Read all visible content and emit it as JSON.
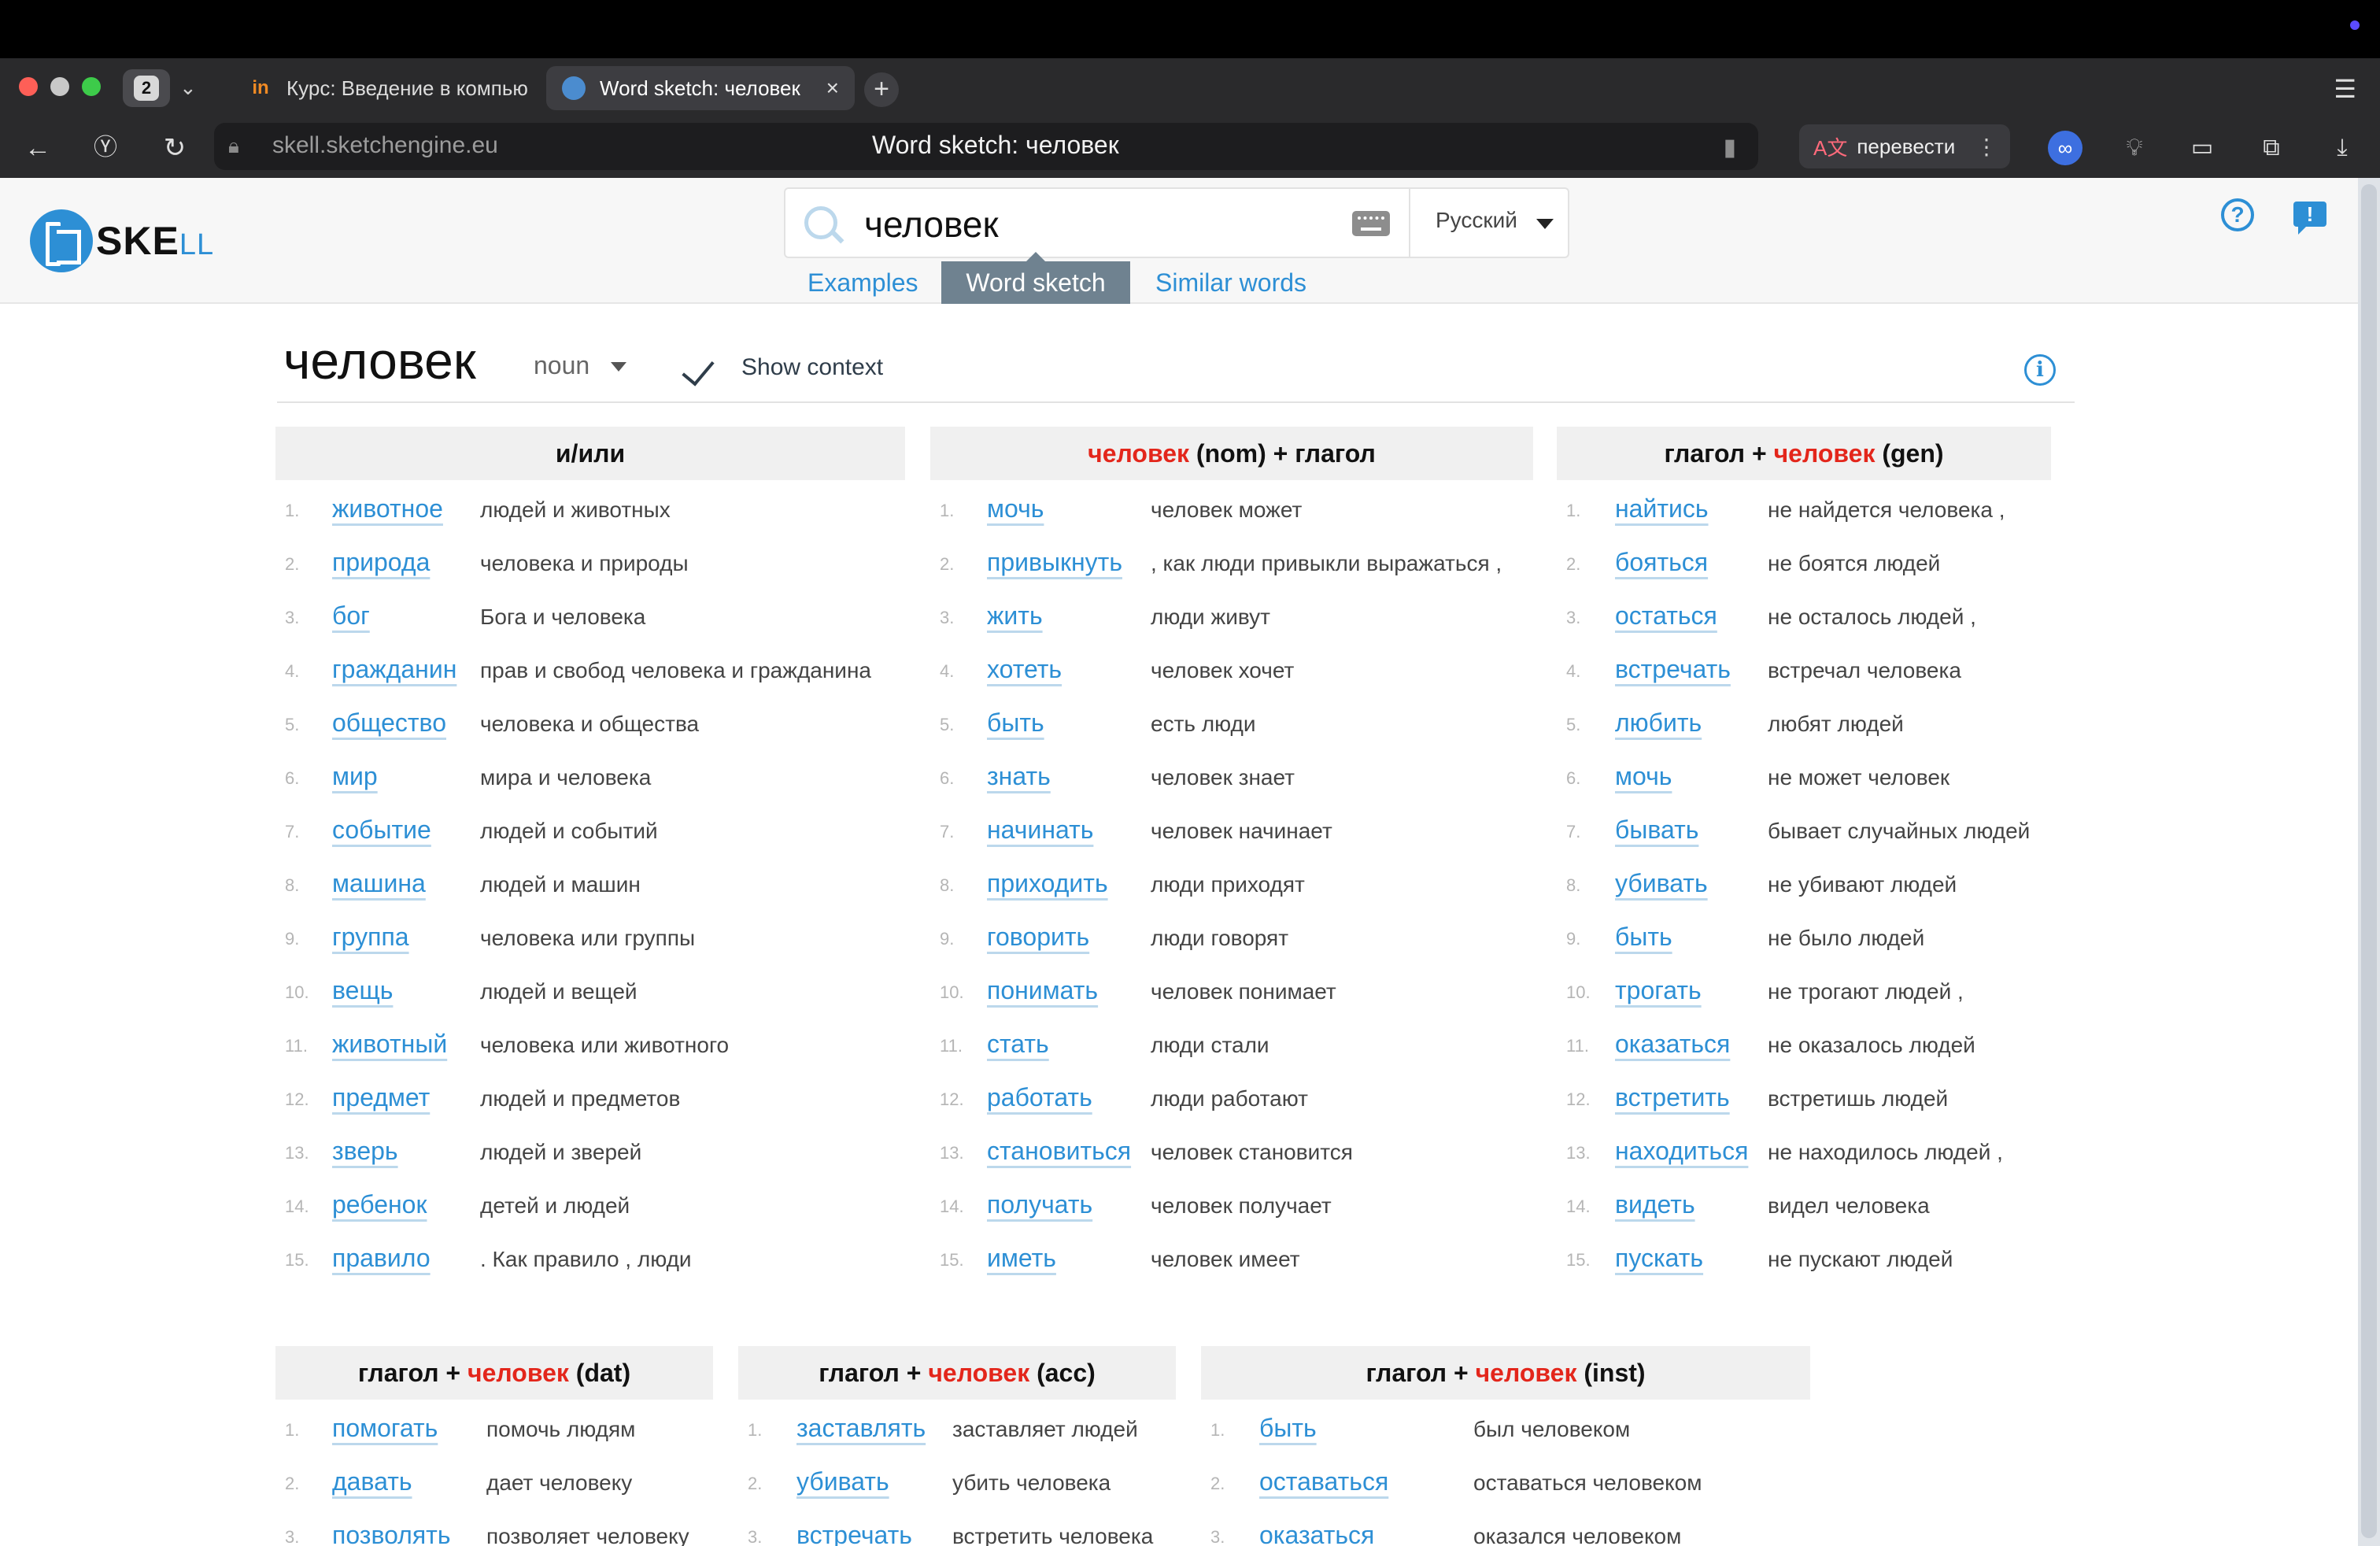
{
  "browser": {
    "tab_count": "2",
    "tabs": [
      {
        "label": "Курс: Введение в компью",
        "active": false
      },
      {
        "label": "Word sketch: человек",
        "active": true
      }
    ],
    "url": "skell.sketchengine.eu",
    "page_title": "Word sketch: человек",
    "translate_label": "перевести"
  },
  "header": {
    "logo_main": "SKE",
    "logo_accent": "LL",
    "search_value": "человек",
    "language": "Русский",
    "tabs": [
      "Examples",
      "Word sketch",
      "Similar words"
    ],
    "active_tab": "Word sketch"
  },
  "word": {
    "lemma": "человек",
    "pos": "noun",
    "show_context_label": "Show context"
  },
  "sketches": [
    {
      "title_pre": "и/или",
      "title_hw": "",
      "title_post": "",
      "rows": [
        {
          "n": "1.",
          "collocate": "животное",
          "example": "людей и животных"
        },
        {
          "n": "2.",
          "collocate": "природа",
          "example": "человека и природы"
        },
        {
          "n": "3.",
          "collocate": "бог",
          "example": "Бога и человека"
        },
        {
          "n": "4.",
          "collocate": "гражданин",
          "example": "прав и свобод человека и гражданина"
        },
        {
          "n": "5.",
          "collocate": "общество",
          "example": "человека и общества"
        },
        {
          "n": "6.",
          "collocate": "мир",
          "example": "мира и человека"
        },
        {
          "n": "7.",
          "collocate": "событие",
          "example": "людей и событий"
        },
        {
          "n": "8.",
          "collocate": "машина",
          "example": "людей и машин"
        },
        {
          "n": "9.",
          "collocate": "группа",
          "example": "человека или группы"
        },
        {
          "n": "10.",
          "collocate": "вещь",
          "example": "людей и вещей"
        },
        {
          "n": "11.",
          "collocate": "животный",
          "example": "человека или животного"
        },
        {
          "n": "12.",
          "collocate": "предмет",
          "example": "людей и предметов"
        },
        {
          "n": "13.",
          "collocate": "зверь",
          "example": "людей и зверей"
        },
        {
          "n": "14.",
          "collocate": "ребенок",
          "example": "детей и людей"
        },
        {
          "n": "15.",
          "collocate": "правило",
          "example": ". Как правило , люди"
        }
      ]
    },
    {
      "title_pre": "",
      "title_hw": "человек",
      "title_post": " (nom) + глагол",
      "rows": [
        {
          "n": "1.",
          "collocate": "мочь",
          "example": "человек может"
        },
        {
          "n": "2.",
          "collocate": "привыкнуть",
          "example": ", как люди привыкли выражаться ,"
        },
        {
          "n": "3.",
          "collocate": "жить",
          "example": "люди живут"
        },
        {
          "n": "4.",
          "collocate": "хотеть",
          "example": "человек хочет"
        },
        {
          "n": "5.",
          "collocate": "быть",
          "example": "есть люди"
        },
        {
          "n": "6.",
          "collocate": "знать",
          "example": "человек знает"
        },
        {
          "n": "7.",
          "collocate": "начинать",
          "example": "человек начинает"
        },
        {
          "n": "8.",
          "collocate": "приходить",
          "example": "люди приходят"
        },
        {
          "n": "9.",
          "collocate": "говорить",
          "example": "люди говорят"
        },
        {
          "n": "10.",
          "collocate": "понимать",
          "example": "человек понимает"
        },
        {
          "n": "11.",
          "collocate": "стать",
          "example": "люди стали"
        },
        {
          "n": "12.",
          "collocate": "работать",
          "example": "люди работают"
        },
        {
          "n": "13.",
          "collocate": "становиться",
          "example": "человек становится"
        },
        {
          "n": "14.",
          "collocate": "получать",
          "example": "человек получает"
        },
        {
          "n": "15.",
          "collocate": "иметь",
          "example": "человек имеет"
        }
      ]
    },
    {
      "title_pre": "глагол + ",
      "title_hw": "человек",
      "title_post": " (gen)",
      "rows": [
        {
          "n": "1.",
          "collocate": "найтись",
          "example": "не найдется человека ,"
        },
        {
          "n": "2.",
          "collocate": "бояться",
          "example": "не боятся людей"
        },
        {
          "n": "3.",
          "collocate": "остаться",
          "example": "не осталось людей ,"
        },
        {
          "n": "4.",
          "collocate": "встречать",
          "example": "встречал человека"
        },
        {
          "n": "5.",
          "collocate": "любить",
          "example": "любят людей"
        },
        {
          "n": "6.",
          "collocate": "мочь",
          "example": "не может человек"
        },
        {
          "n": "7.",
          "collocate": "бывать",
          "example": "бывает случайных людей"
        },
        {
          "n": "8.",
          "collocate": "убивать",
          "example": "не убивают людей"
        },
        {
          "n": "9.",
          "collocate": "быть",
          "example": "не было людей"
        },
        {
          "n": "10.",
          "collocate": "трогать",
          "example": "не трогают людей ,"
        },
        {
          "n": "11.",
          "collocate": "оказаться",
          "example": "не оказалось людей"
        },
        {
          "n": "12.",
          "collocate": "встретить",
          "example": "встретишь людей"
        },
        {
          "n": "13.",
          "collocate": "находиться",
          "example": "не находилось людей ,"
        },
        {
          "n": "14.",
          "collocate": "видеть",
          "example": "видел человека"
        },
        {
          "n": "15.",
          "collocate": "пускать",
          "example": "не пускают людей"
        }
      ]
    },
    {
      "title_pre": "глагол + ",
      "title_hw": "человек",
      "title_post": " (dat)",
      "rows": [
        {
          "n": "1.",
          "collocate": "помогать",
          "example": "помочь людям"
        },
        {
          "n": "2.",
          "collocate": "давать",
          "example": "дает человеку"
        },
        {
          "n": "3.",
          "collocate": "позволять",
          "example": "позволяет человеку"
        }
      ]
    },
    {
      "title_pre": "глагол + ",
      "title_hw": "человек",
      "title_post": " (acc)",
      "rows": [
        {
          "n": "1.",
          "collocate": "заставлять",
          "example": "заставляет людей"
        },
        {
          "n": "2.",
          "collocate": "убивать",
          "example": "убить человека"
        },
        {
          "n": "3.",
          "collocate": "встречать",
          "example": "встретить человека"
        }
      ]
    },
    {
      "title_pre": "глагол + ",
      "title_hw": "человек",
      "title_post": " (inst)",
      "rows": [
        {
          "n": "1.",
          "collocate": "быть",
          "example": "был человеком"
        },
        {
          "n": "2.",
          "collocate": "оставаться",
          "example": "оставаться человеком"
        },
        {
          "n": "3.",
          "collocate": "оказаться",
          "example": "оказался человеком"
        }
      ]
    }
  ],
  "colors": {
    "link": "#2d8fd5",
    "headword": "#e3261b",
    "active_tab": "#6f8290"
  }
}
